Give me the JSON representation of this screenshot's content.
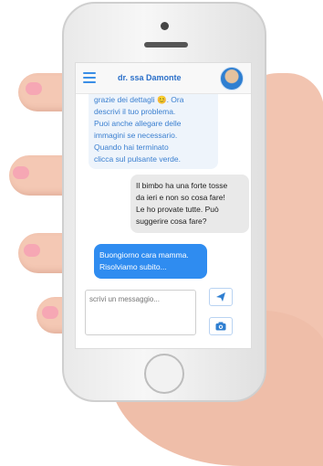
{
  "header": {
    "title": "dr. ssa Damonte",
    "menu_icon": "hamburger-menu-icon",
    "avatar": "doctor-avatar"
  },
  "messages": {
    "partial": [
      "grazie dei dettagli 😊. Ora",
      "descrivi il tuo problema.",
      "Puoi anche allegare delle",
      "immagini se necessario.",
      "Quando hai terminato",
      "clicca sul pulsante verde."
    ],
    "outgoing": [
      "Il bimbo ha una forte tosse",
      "da ieri e non so cosa fare!",
      "Le ho provate tutte. Può",
      "suggerire cosa fare?"
    ],
    "incoming": [
      "Buongiorno cara mamma.",
      "Risolviamo subito..."
    ]
  },
  "composer": {
    "placeholder": "scrivi un messaggio...",
    "send_icon": "paper-plane-icon",
    "camera_icon": "camera-icon"
  },
  "colors": {
    "accent": "#2f8cf0",
    "title": "#2a6fc9",
    "incoming_bubble": "#2f8cf0",
    "outgoing_bubble": "#e9e9e9"
  }
}
